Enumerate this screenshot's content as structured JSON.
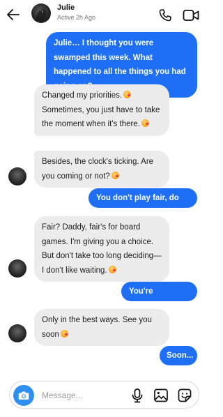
{
  "header": {
    "name": "Julie",
    "status": "Active 2h Ago"
  },
  "messages": [
    {
      "side": "out",
      "text": "Julie… I thought you were swamped this week. What happened to all the things you had going on?"
    },
    {
      "side": "in",
      "text": "Changed my priorities.",
      "text2": "Sometimes, you just have to take the moment when it's there."
    },
    {
      "side": "in",
      "text": "Besides, the clock's ticking. Are you coming or not?"
    },
    {
      "side": "out",
      "text": "You don't play fair, do you?"
    },
    {
      "side": "in",
      "text": "Fair? Daddy, fair's for board games. I'm giving you a choice. But don't take too long deciding— I don't like waiting."
    },
    {
      "side": "out",
      "text": "You're dangerous"
    },
    {
      "side": "in",
      "text": "Only in the best ways. See you soon"
    },
    {
      "side": "out",
      "text": "Soon..."
    }
  ],
  "composer": {
    "placeholder": "Message..."
  },
  "icons": {
    "back": "arrow-left-icon",
    "call": "phone-icon",
    "video": "video-camera-icon",
    "camera": "camera-icon",
    "mic": "microphone-icon",
    "gallery": "image-icon",
    "sticker": "sticker-icon"
  },
  "colors": {
    "outgoing_bubble": "#1e6ff5",
    "incoming_bubble": "#ececec",
    "camera_button": "#2f8ef2"
  }
}
